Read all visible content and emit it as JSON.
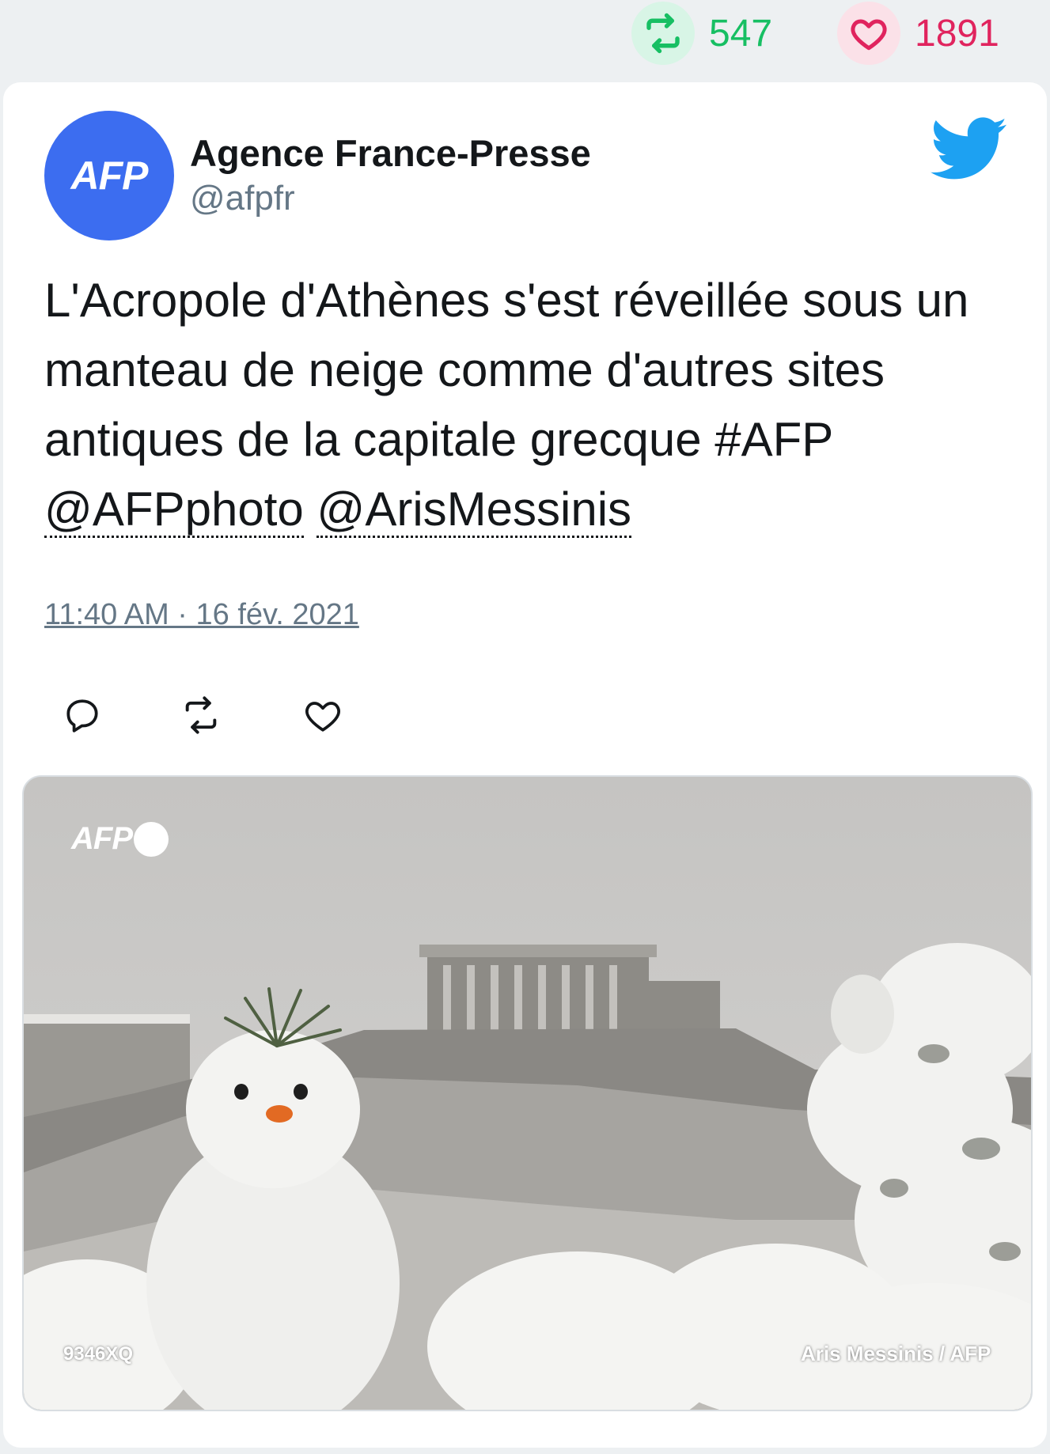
{
  "stats": {
    "retweets": "547",
    "likes": "1891",
    "retweet_color": "#17bf63",
    "like_color": "#e0245e"
  },
  "author": {
    "avatar_text": "AFP",
    "name": "Agence France-Presse",
    "handle": "@afpfr",
    "avatar_color": "#3c6df0"
  },
  "platform_icon": "twitter-bird-icon",
  "tweet": {
    "text_plain": "L'Acropole d'Athènes s'est réveillée sous un manteau de neige comme d'autres sites antiques de la capitale grecque #AFP ",
    "mention_1": "@AFPphoto",
    "separator": " ",
    "mention_2": "@ArisMessinis",
    "timestamp": "11:40 AM · 16 fév. 2021"
  },
  "actions": [
    {
      "icon": "reply-icon"
    },
    {
      "icon": "retweet-icon"
    },
    {
      "icon": "like-icon"
    }
  ],
  "media": {
    "watermark": "AFP",
    "photo_id": "9346XQ",
    "credit": "Aris Messinis / AFP"
  }
}
